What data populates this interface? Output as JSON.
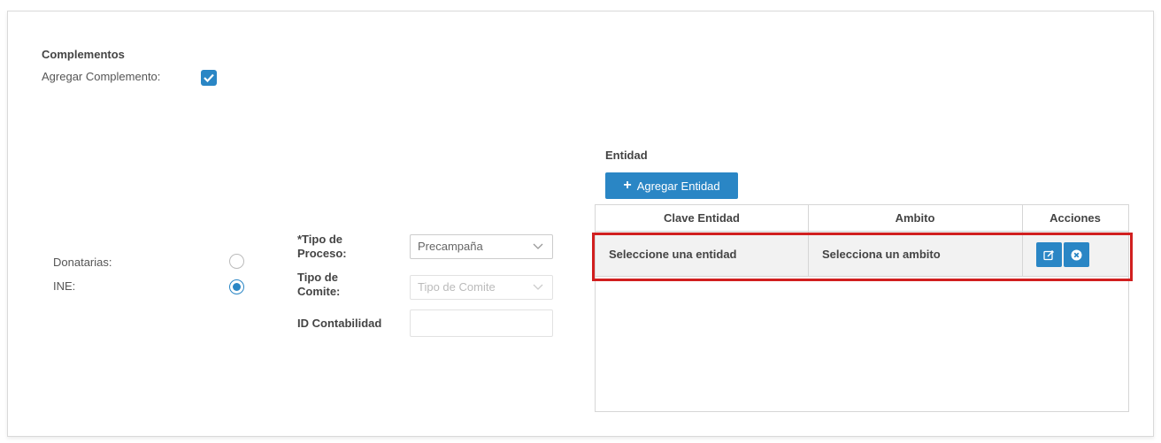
{
  "complementos": {
    "title": "Complementos",
    "agregar_label": "Agregar Complemento:",
    "agregar_checked": true
  },
  "tipo_sujeto": {
    "options": [
      {
        "label": "Donatarias:",
        "selected": false
      },
      {
        "label": "INE:",
        "selected": true
      }
    ]
  },
  "form": {
    "tipo_proceso_label_1": "*Tipo de",
    "tipo_proceso_label_2": "Proceso:",
    "tipo_proceso_value": "Precampaña",
    "tipo_comite_label_1": "Tipo de",
    "tipo_comite_label_2": "Comite:",
    "tipo_comite_placeholder": "Tipo de Comite",
    "id_contabilidad_label": "ID Contabilidad",
    "id_contabilidad_value": ""
  },
  "entidad": {
    "label": "Entidad",
    "add_button": "Agregar Entidad",
    "columns": [
      "Clave Entidad",
      "Ambito",
      "Acciones"
    ],
    "rows": [
      {
        "clave": "Seleccione una entidad",
        "ambito": "Selecciona un ambito"
      }
    ],
    "highlight_color": "#d11f1f"
  },
  "colors": {
    "accent": "#2a86c5"
  }
}
